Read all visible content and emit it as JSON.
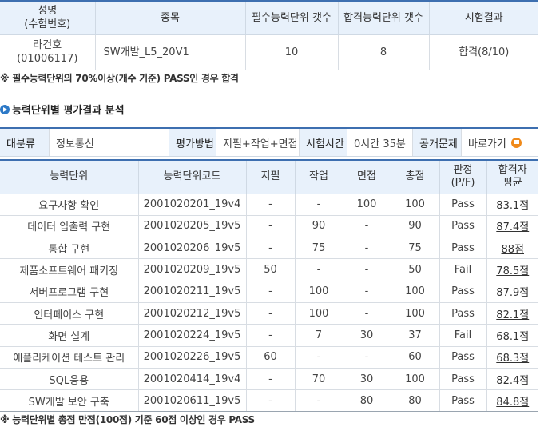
{
  "summary": {
    "headers": [
      "성명",
      "(수험번호)",
      "종목",
      "필수능력단위 갯수",
      "합격능력단위 갯수",
      "시험결과"
    ],
    "name": "라건호",
    "exam_no": "(01006117)",
    "subject": "SW개발_L5_20V1",
    "required_units": "10",
    "passed_units": "8",
    "result": "합격(8/10)"
  },
  "note_top": "※ 필수능력단위의 70%이상(개수 기준) PASS인 경우 합격",
  "section_title": "능력단위별 평가결과 분석",
  "info_bar": {
    "category_label": "대분류",
    "category_value": "정보통신",
    "method_label": "평가방법",
    "method_value": "지필+작업+면접",
    "time_label": "시험시간",
    "time_value": "0시간 35분",
    "public_label": "공개문제",
    "goto_label": "바로가기"
  },
  "results": {
    "headers": {
      "unit": "능력단위",
      "code": "능력단위코드",
      "written": "지필",
      "practical": "작업",
      "interview": "면접",
      "total": "총점",
      "judge_1": "판정",
      "judge_2": "(P/F)",
      "avg_1": "합격자",
      "avg_2": "평균"
    },
    "rows": [
      {
        "unit": "요구사항 확인",
        "code": "2001020201_19v4",
        "written": "-",
        "practical": "-",
        "interview": "100",
        "total": "100",
        "judge": "Pass",
        "avg": "83.1점"
      },
      {
        "unit": "데이터 입출력 구현",
        "code": "2001020205_19v5",
        "written": "-",
        "practical": "90",
        "interview": "-",
        "total": "90",
        "judge": "Pass",
        "avg": "87.4점"
      },
      {
        "unit": "통합 구현",
        "code": "2001020206_19v5",
        "written": "-",
        "practical": "75",
        "interview": "-",
        "total": "75",
        "judge": "Pass",
        "avg": "88점"
      },
      {
        "unit": "제품소프트웨어 패키징",
        "code": "2001020209_19v5",
        "written": "50",
        "practical": "-",
        "interview": "-",
        "total": "50",
        "judge": "Fail",
        "avg": "78.5점"
      },
      {
        "unit": "서버프로그램 구현",
        "code": "2001020211_19v5",
        "written": "-",
        "practical": "100",
        "interview": "-",
        "total": "100",
        "judge": "Pass",
        "avg": "87.9점"
      },
      {
        "unit": "인터페이스 구현",
        "code": "2001020212_19v5",
        "written": "-",
        "practical": "100",
        "interview": "-",
        "total": "100",
        "judge": "Pass",
        "avg": "82.1점"
      },
      {
        "unit": "화면 설계",
        "code": "2001020224_19v5",
        "written": "-",
        "practical": "7",
        "interview": "30",
        "total": "37",
        "judge": "Fail",
        "avg": "68.1점"
      },
      {
        "unit": "애플리케이션 테스트 관리",
        "code": "2001020226_19v5",
        "written": "60",
        "practical": "-",
        "interview": "-",
        "total": "60",
        "judge": "Pass",
        "avg": "68.3점"
      },
      {
        "unit": "SQL응용",
        "code": "2001020414_19v4",
        "written": "-",
        "practical": "70",
        "interview": "30",
        "total": "100",
        "judge": "Pass",
        "avg": "82.4점"
      },
      {
        "unit": "SW개발 보안 구축",
        "code": "2001020611_19v5",
        "written": "-",
        "practical": "-",
        "interview": "80",
        "total": "80",
        "judge": "Pass",
        "avg": "84.8점"
      }
    ]
  },
  "note_bottom": "※ 능력단위별 총점 만점(100점) 기준 60점 이상인 경우 PASS",
  "colors": {
    "accent": "#3d6fb0",
    "header_bg": "#e8f1fb",
    "pass": "#1d3fcf",
    "fail": "#e0241b",
    "goto_icon": "#f08a1a"
  }
}
